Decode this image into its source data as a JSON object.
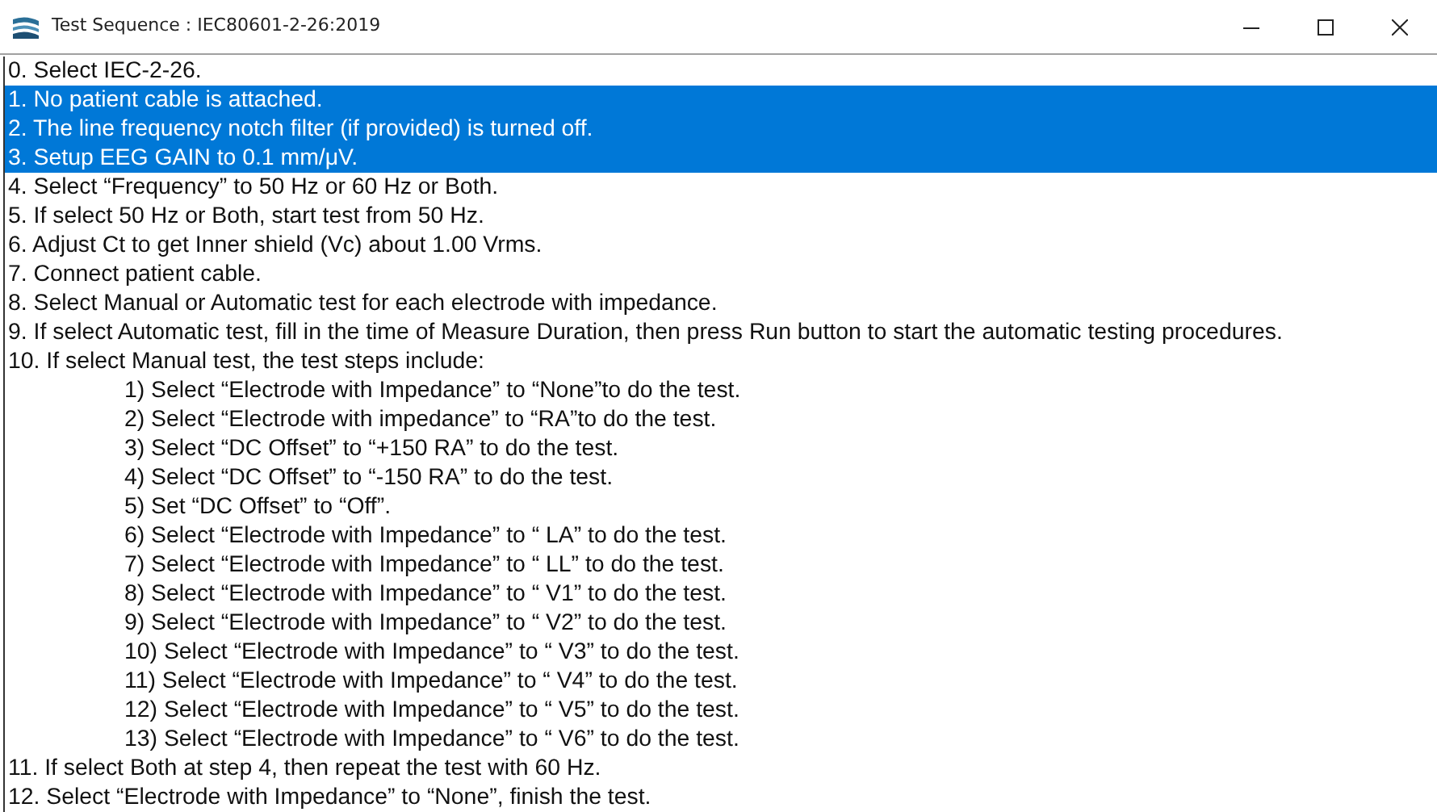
{
  "window": {
    "title": "Test Sequence : IEC80601-2-26:2019"
  },
  "steps": [
    {
      "kind": "step",
      "text": "0. Select IEC-2-26.",
      "selected": false
    },
    {
      "kind": "step",
      "text": "1. No patient cable is attached.",
      "selected": true
    },
    {
      "kind": "step",
      "text": "2. The line frequency notch filter (if provided) is turned off.",
      "selected": true
    },
    {
      "kind": "step",
      "text": "3. Setup EEG GAIN to 0.1 mm/μV.",
      "selected": true
    },
    {
      "kind": "step",
      "text": "4. Select “Frequency” to 50 Hz or 60 Hz or Both.",
      "selected": false
    },
    {
      "kind": "step",
      "text": "5. If select 50 Hz or Both, start test from 50 Hz.",
      "selected": false
    },
    {
      "kind": "step",
      "text": "6. Adjust Ct to get Inner shield (Vc) about 1.00 Vrms.",
      "selected": false
    },
    {
      "kind": "step",
      "text": "7. Connect patient cable.",
      "selected": false
    },
    {
      "kind": "step",
      "text": "8. Select Manual or Automatic test for each electrode with impedance.",
      "selected": false
    },
    {
      "kind": "step",
      "text": "9. If select Automatic test, fill in the time of Measure Duration, then press Run button to start the automatic testing procedures.",
      "selected": false
    },
    {
      "kind": "step",
      "text": "10. If select Manual test, the test steps include:",
      "selected": false
    },
    {
      "kind": "substep",
      "text": "1) Select  “Electrode with Impedance” to “None”to do the test.",
      "selected": false
    },
    {
      "kind": "substep",
      "text": "2) Select “Electrode with impedance” to “RA”to do the test.",
      "selected": false
    },
    {
      "kind": "substep",
      "text": "3) Select “DC Offset” to “+150 RA” to do the test.",
      "selected": false
    },
    {
      "kind": "substep",
      "text": "4) Select “DC Offset” to  “-150 RA” to do the test.",
      "selected": false
    },
    {
      "kind": "substep",
      "text": "5) Set “DC Offset” to “Off”.",
      "selected": false
    },
    {
      "kind": "substep",
      "text": "6) Select “Electrode with Impedance” to “ LA” to do the test.",
      "selected": false
    },
    {
      "kind": "substep",
      "text": "7) Select “Electrode with Impedance” to “ LL” to do the test.",
      "selected": false
    },
    {
      "kind": "substep",
      "text": "8) Select “Electrode with Impedance” to “ V1” to do the test.",
      "selected": false
    },
    {
      "kind": "substep",
      "text": "9) Select “Electrode with Impedance” to “ V2” to do the test.",
      "selected": false
    },
    {
      "kind": "substep",
      "text": "10) Select “Electrode with Impedance” to “ V3” to do the test.",
      "selected": false
    },
    {
      "kind": "substep",
      "text": "11) Select “Electrode with Impedance” to “ V4” to do the test.",
      "selected": false
    },
    {
      "kind": "substep",
      "text": "12) Select “Electrode with Impedance” to “ V5” to do the test.",
      "selected": false
    },
    {
      "kind": "substep",
      "text": "13) Select “Electrode with Impedance” to “ V6” to do the test.",
      "selected": false
    },
    {
      "kind": "step",
      "text": "11. If select Both at step 4, then repeat the test with 60 Hz.",
      "selected": false
    },
    {
      "kind": "step",
      "text": "12. Select “Electrode with Impedance” to “None”, finish the test.",
      "selected": false
    }
  ]
}
